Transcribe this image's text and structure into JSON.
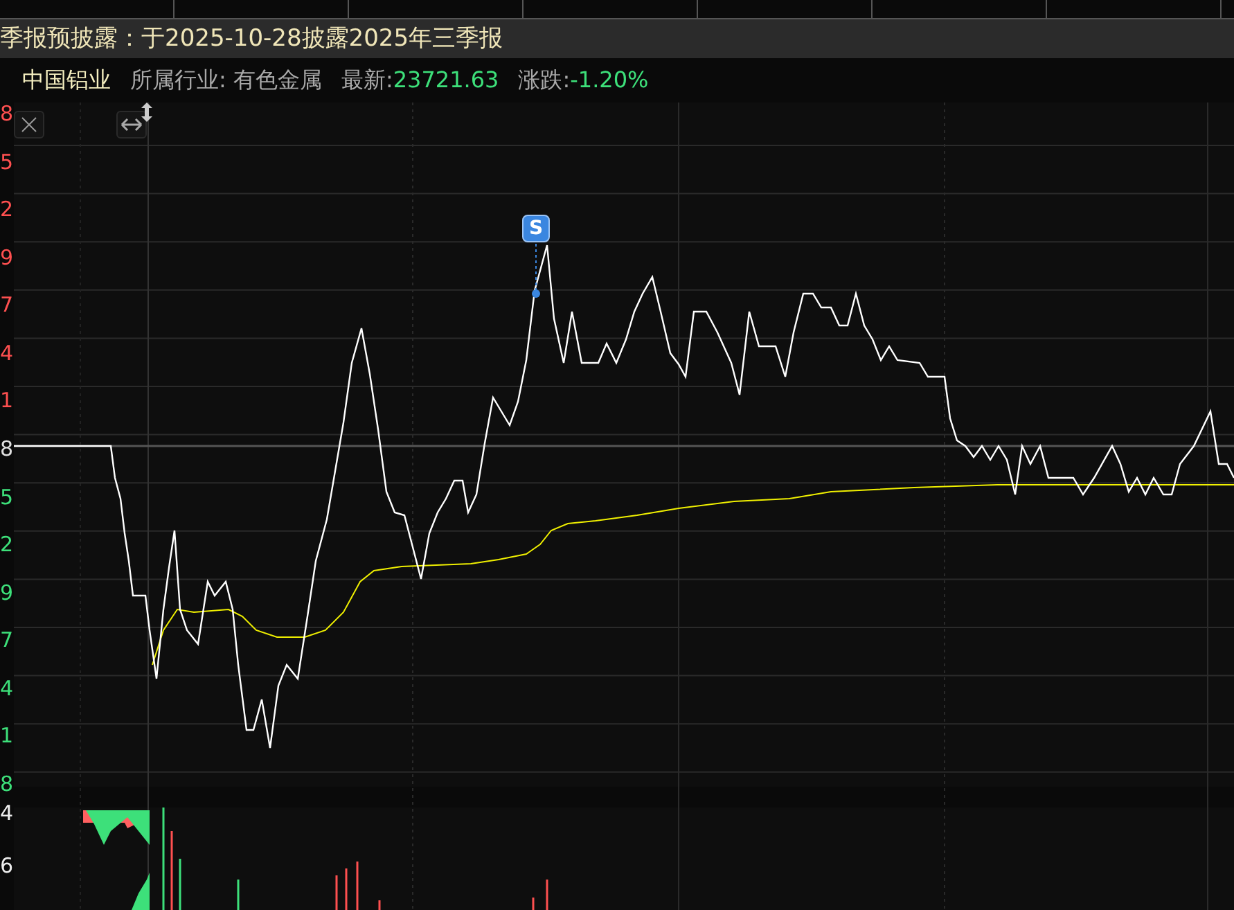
{
  "notice": {
    "text": "季报预披露：于2025-10-28披露2025年三季报"
  },
  "quote": {
    "name": "中国铝业",
    "industry_label": "所属行业:",
    "industry": "有色金属",
    "latest_label": "最新:",
    "latest": "23721.63",
    "change_label": "涨跌:",
    "change": "-1.20%"
  },
  "price_axis": [
    {
      "label": "8",
      "kind": "up"
    },
    {
      "label": "5",
      "kind": "up"
    },
    {
      "label": "2",
      "kind": "up"
    },
    {
      "label": "9",
      "kind": "up"
    },
    {
      "label": "7",
      "kind": "up"
    },
    {
      "label": "4",
      "kind": "up"
    },
    {
      "label": "1",
      "kind": "up"
    },
    {
      "label": "8",
      "kind": "flat"
    },
    {
      "label": "5",
      "kind": "down"
    },
    {
      "label": "2",
      "kind": "down"
    },
    {
      "label": "9",
      "kind": "down"
    },
    {
      "label": "7",
      "kind": "down"
    },
    {
      "label": "4",
      "kind": "down"
    },
    {
      "label": "1",
      "kind": "down"
    },
    {
      "label": "8",
      "kind": "down"
    }
  ],
  "volume_axis": [
    "4",
    "6"
  ],
  "marker": {
    "label": "S"
  }
}
